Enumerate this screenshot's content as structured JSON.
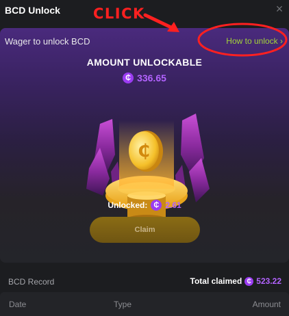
{
  "header": {
    "title": "BCD Unlock",
    "close_icon": "close-icon"
  },
  "annotation": {
    "text": "CLICK",
    "color": "#ff2020"
  },
  "card": {
    "subtitle": "Wager to unlock BCD",
    "how_link": "How to unlock ›",
    "amount_title": "AMOUNT UNLOCKABLE",
    "coin_symbol": "₵",
    "amount_value": "336.65",
    "unlocked_label": "Unlocked:",
    "unlocked_value": "2.61",
    "claim_label": "Claim",
    "illustration_icon": "coin-pedestal-crystals-icon"
  },
  "record": {
    "label": "BCD Record",
    "total_label": "Total claimed",
    "total_value": "523.22",
    "columns": [
      "Date",
      "Type",
      "Amount"
    ]
  },
  "colors": {
    "accent_purple": "#b363ff",
    "link_green": "#a4d339",
    "claim_gold": "#8a6c15",
    "background": "#1c1d20"
  }
}
